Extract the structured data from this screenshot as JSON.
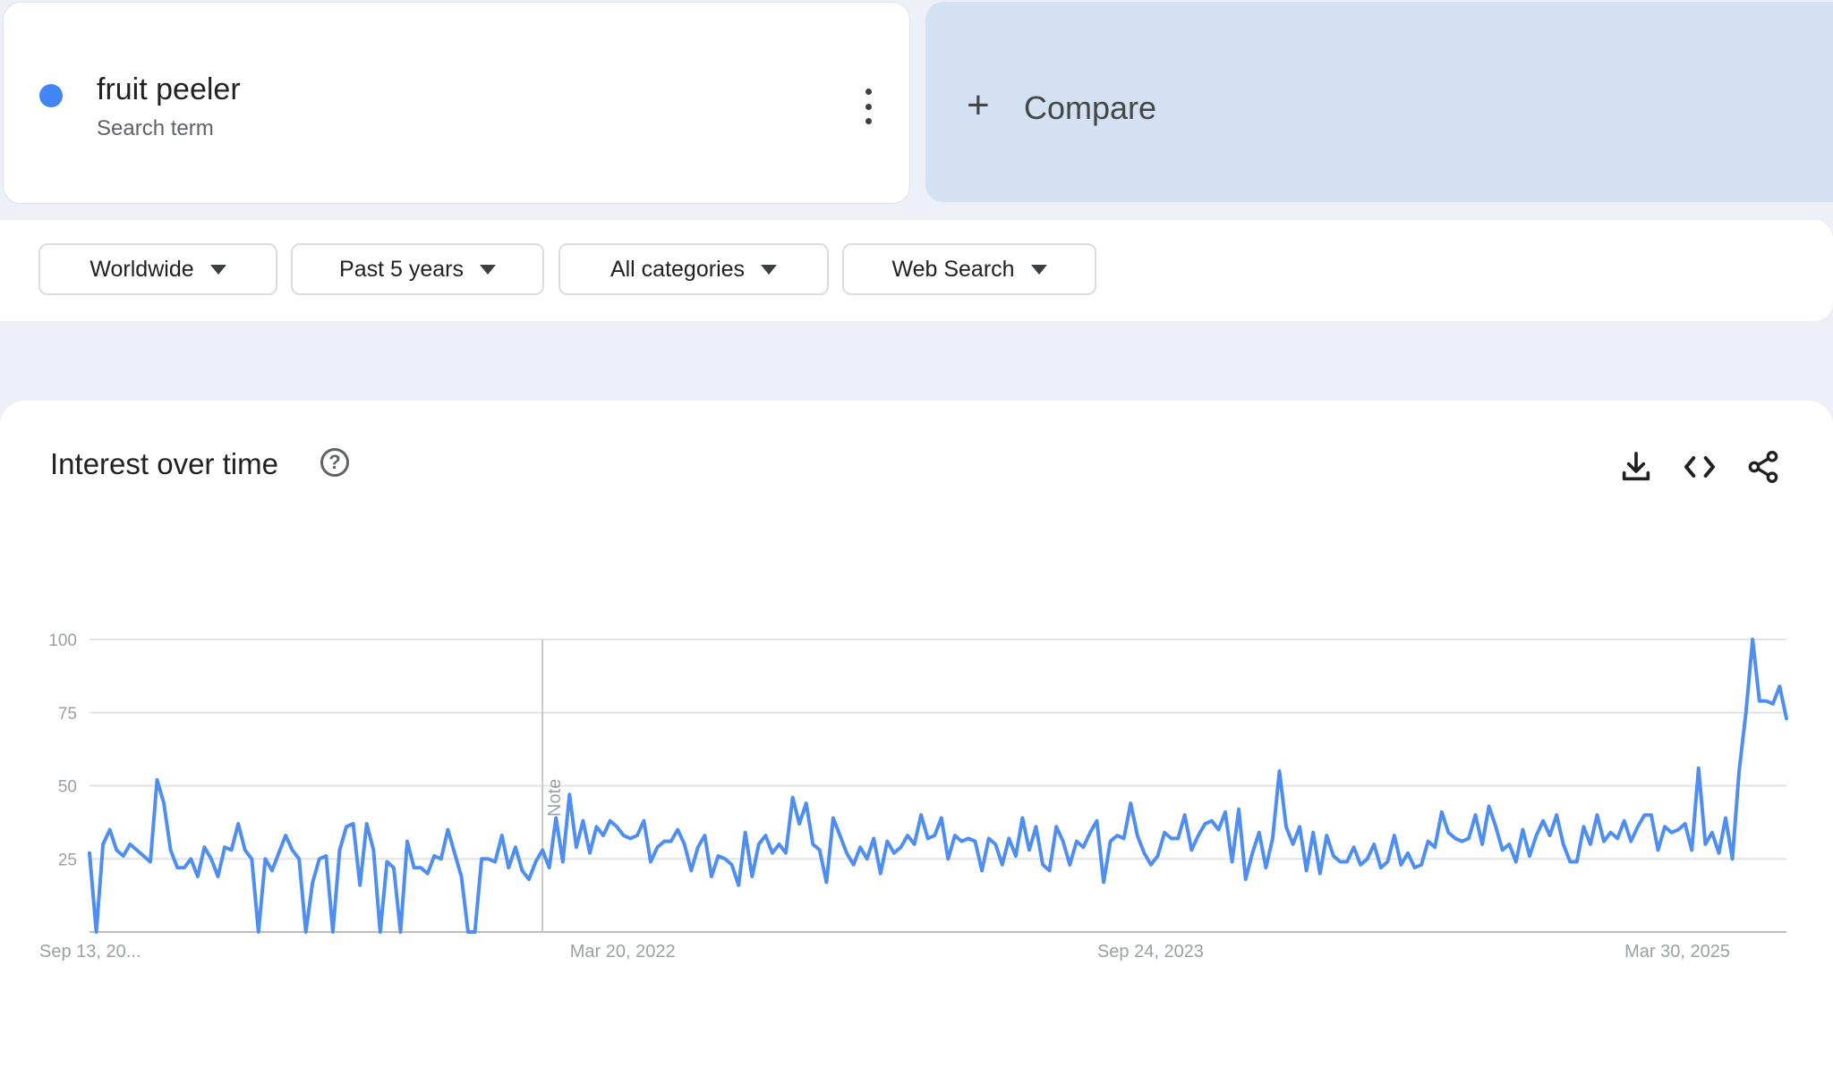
{
  "term": {
    "name": "fruit peeler",
    "subtitle": "Search term",
    "dot_color": "#4285f4"
  },
  "compare": {
    "plus": "+",
    "label": "Compare"
  },
  "filters": [
    {
      "label": "Worldwide"
    },
    {
      "label": "Past 5 years"
    },
    {
      "label": "All categories"
    },
    {
      "label": "Web Search"
    }
  ],
  "panel": {
    "title": "Interest over time",
    "help_icon": "help-circle-icon",
    "actions": [
      "download-icon",
      "embed-code-icon",
      "share-icon"
    ]
  },
  "chart_data": {
    "type": "line",
    "title": "",
    "xlabel": "",
    "ylabel": "",
    "ylim": [
      0,
      100
    ],
    "y_ticks": [
      25,
      50,
      75,
      100
    ],
    "x_tick_labels": [
      "Sep 13, 20...",
      "Mar 20, 2022",
      "Sep 24, 2023",
      "Mar 30, 2025"
    ],
    "x_tick_indices": [
      0,
      79,
      157,
      235
    ],
    "annotation": {
      "label": "Note",
      "index": 67
    },
    "grid": true,
    "line_color": "#4e8ef0",
    "series": [
      {
        "values": [
          27,
          0,
          30,
          35,
          28,
          26,
          30,
          28,
          26,
          24,
          52,
          44,
          28,
          22,
          22,
          25,
          19,
          29,
          25,
          19,
          29,
          28,
          37,
          28,
          25,
          0,
          25,
          21,
          27,
          33,
          28,
          25,
          0,
          17,
          25,
          26,
          0,
          28,
          36,
          37,
          16,
          37,
          28,
          0,
          24,
          22,
          0,
          31,
          22,
          22,
          20,
          26,
          25,
          35,
          27,
          19,
          0,
          0,
          25,
          25,
          24,
          33,
          22,
          29,
          21,
          18,
          24,
          28,
          22,
          39,
          24,
          47,
          29,
          38,
          27,
          36,
          33,
          38,
          36,
          33,
          32,
          33,
          38,
          24,
          29,
          31,
          31,
          35,
          30,
          21,
          29,
          33,
          19,
          26,
          25,
          23,
          16,
          34,
          19,
          30,
          33,
          27,
          30,
          27,
          46,
          37,
          44,
          30,
          28,
          17,
          39,
          33,
          27,
          23,
          29,
          25,
          32,
          20,
          31,
          27,
          29,
          33,
          30,
          40,
          32,
          33,
          39,
          25,
          33,
          31,
          32,
          31,
          21,
          32,
          30,
          23,
          32,
          26,
          39,
          28,
          36,
          23,
          21,
          36,
          31,
          23,
          31,
          29,
          34,
          38,
          17,
          31,
          33,
          32,
          44,
          33,
          27,
          23,
          26,
          34,
          32,
          32,
          40,
          28,
          33,
          37,
          38,
          35,
          41,
          24,
          42,
          18,
          27,
          34,
          22,
          32,
          55,
          36,
          30,
          36,
          21,
          34,
          20,
          33,
          26,
          24,
          24,
          29,
          23,
          25,
          30,
          22,
          24,
          33,
          23,
          27,
          22,
          23,
          31,
          29,
          41,
          34,
          32,
          31,
          32,
          40,
          30,
          43,
          36,
          28,
          30,
          24,
          35,
          26,
          33,
          38,
          33,
          40,
          30,
          24,
          24,
          36,
          30,
          40,
          31,
          34,
          32,
          38,
          31,
          36,
          40,
          40,
          28,
          36,
          34,
          35,
          37,
          28,
          56,
          30,
          34,
          27,
          39,
          25,
          55,
          75,
          100,
          79,
          79,
          78,
          84,
          73
        ]
      }
    ]
  }
}
